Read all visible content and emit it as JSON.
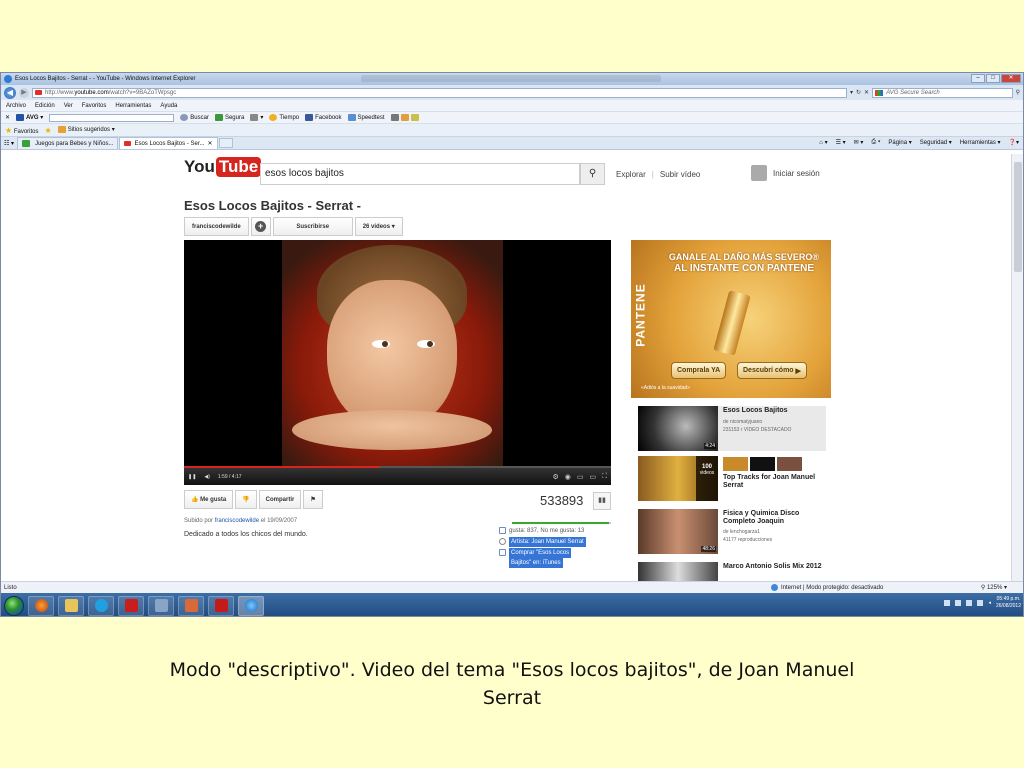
{
  "window": {
    "title": "Esos Locos Bajitos - Serrat - - YouTube - Windows Internet Explorer",
    "buttons": [
      "–",
      "□",
      "✕"
    ]
  },
  "address_bar": {
    "url_prefix": "http://www.",
    "url_domain": "youtube.com",
    "url_path": "/watch?v=9BAZoTWpsgc",
    "search_placeholder": "AVG Secure Search"
  },
  "menu": [
    "Archivo",
    "Edición",
    "Ver",
    "Favoritos",
    "Herramientas",
    "Ayuda"
  ],
  "avg_toolbar": {
    "brand": "AVG",
    "buttons": [
      "Buscar",
      "Segura",
      "Tiempo",
      "Facebook",
      "Speedtest"
    ]
  },
  "favorites_bar": {
    "favorites_label": "Favoritos",
    "suggested_sites": "Sitios sugeridos"
  },
  "tabs": [
    {
      "label": "Juegos para Bebes y Niños..."
    },
    {
      "label": "Esos Locos Bajitos - Ser..."
    }
  ],
  "command_bar": [
    "Página",
    "Seguridad",
    "Herramientas"
  ],
  "youtube": {
    "logo_you": "You",
    "logo_tube": "Tube",
    "search_query": "esos locos bajitos",
    "nav": [
      "Explorar",
      "Subir vídeo"
    ],
    "signin": "Iniciar sesión",
    "video_title": "Esos Locos Bajitos - Serrat -",
    "channel": "franciscodewilde",
    "subscribe": "Suscribirse",
    "videos_count": "26 vídeos",
    "player_time": "1:59 / 4:17",
    "progress": 0.46,
    "like_label": "Me gusta",
    "share_label": "Compartir",
    "views": "533893",
    "published_prefix": "Subido por",
    "published_channel": "franciscodewilde",
    "published_date": "el 19/09/2007",
    "description": "Dedicado a todos los chicos del mundo.",
    "likes_text": "gusta: 837, No me gusta: 13",
    "like_ratio": 0.98,
    "artist_text": "Artista: Joan Manuel Serrat",
    "buy_text_1": "Comprar \"Esos Locos",
    "buy_text_2": "Bajitos\" en: iTunes"
  },
  "ad": {
    "headline_1": "GANALE AL DAÑO MÁS SEVERO®",
    "headline_2": "AL INSTANTE CON PANTENE",
    "brand": "PANTENE",
    "btn_buy": "Comprala YA",
    "btn_discover": "Descubrí cómo",
    "footer": "«Adiós a la suavidad»"
  },
  "related": [
    {
      "title": "Esos Locos Bajitos",
      "line1": "de nicomatyjuano",
      "line2": "231153 r   VIDEO DESTACADO",
      "duration": "4:24"
    },
    {
      "title": "Top Tracks for Joan Manuel Serrat",
      "playlist_count": "100",
      "playlist_word": "videos"
    },
    {
      "title": "Fisica y Quimica Disco Completo Joaquin",
      "line1": "de lenchogarza1",
      "line2": "41177 reproducciones",
      "duration": "48:26"
    },
    {
      "title": "Marco Antonio Solis Mix 2012"
    }
  ],
  "status_bar": {
    "left": "Listo",
    "zone": "Internet | Modo protegido: desactivado",
    "zoom": "125%"
  },
  "taskbar": {
    "time": "05:49 p.m.",
    "date": "26/08/2012"
  },
  "caption": {
    "line1": "Modo \"descriptivo\". Video del tema \"Esos locos bajitos\", de Joan Manuel",
    "line2": "Serrat"
  },
  "colors": {
    "slide_bg": "#FFFFCC",
    "youtube_red": "#D6251F",
    "selection_blue": "#3575D6"
  }
}
